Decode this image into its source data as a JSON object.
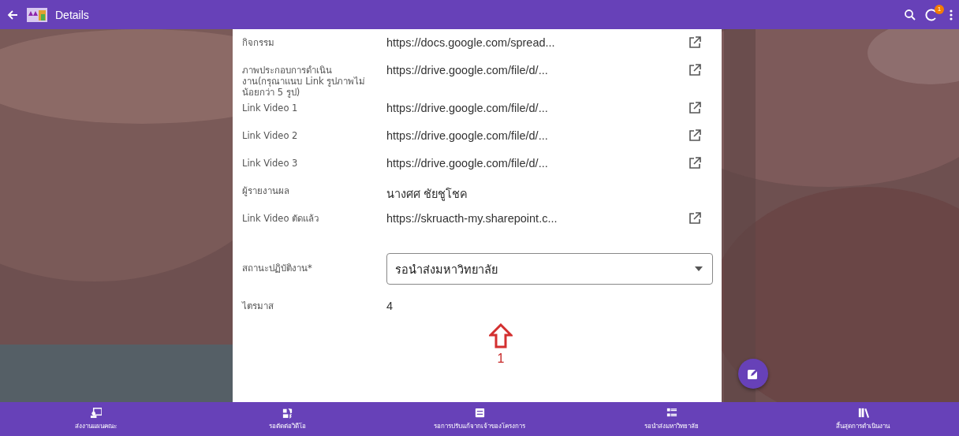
{
  "app_bar": {
    "title": "Details",
    "notification_count": "1"
  },
  "fields": [
    {
      "kind": "link",
      "label": "กิจกรรม",
      "value": "https://docs.google.com/spread..."
    },
    {
      "kind": "link",
      "label": "ภาพประกอบการดำเนินงาน(กรุณาแนบ Link รูปภาพไม่น้อยกว่า 5 รูป)",
      "value": "https://drive.google.com/file/d/..."
    },
    {
      "kind": "link",
      "label": "Link Video 1",
      "value": "https://drive.google.com/file/d/..."
    },
    {
      "kind": "link",
      "label": "Link Video 2",
      "value": "https://drive.google.com/file/d/..."
    },
    {
      "kind": "link",
      "label": "Link Video 3",
      "value": "https://drive.google.com/file/d/..."
    },
    {
      "kind": "text",
      "label": "ผู้รายงานผล",
      "value": "นางศศ ชัยชูโชค"
    },
    {
      "kind": "link",
      "label": "Link Video ตัดแล้ว",
      "value": "https://skruacth-my.sharepoint.c..."
    },
    {
      "kind": "select",
      "label": "สถานะปฏิบัติงาน*",
      "value": "รอนำส่งมหาวิทยาลัย"
    },
    {
      "kind": "text",
      "label": "ไตรมาส",
      "value": "4"
    }
  ],
  "annotation": {
    "label": "1"
  },
  "bottom_nav": [
    {
      "label": "ส่งงานแผนคณะ"
    },
    {
      "label": "รอตัดต่อวิดีโอ"
    },
    {
      "label": "รอการปรับแก้จากเจ้าของโครงการ"
    },
    {
      "label": "รอนำส่งมหาวิทยาลัย"
    },
    {
      "label": "สิ้นสุดการดำเนินงาน"
    }
  ]
}
